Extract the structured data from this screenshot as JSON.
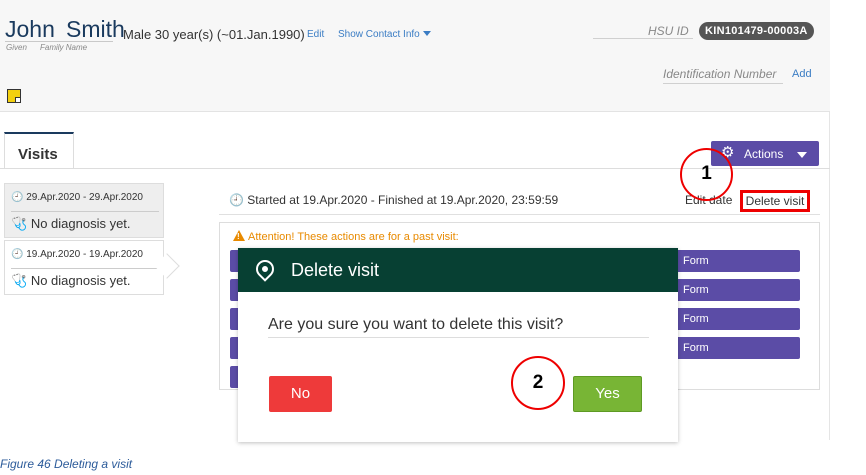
{
  "patient": {
    "given": "John",
    "family": "Smith",
    "given_hint": "Given",
    "family_hint": "Family Name",
    "demographics": "Male  30 year(s) (~01.Jan.1990)",
    "edit_link": "Edit",
    "contact_link": "Show Contact Info",
    "hsu_label": "HSU ID",
    "hsu_id": "KIN101479-00003A",
    "id_label": "Identification Number",
    "id_add": "Add"
  },
  "tabs": {
    "visits": "Visits"
  },
  "actions": {
    "label": "Actions"
  },
  "visits": [
    {
      "dates": "29.Apr.2020 - 29.Apr.2020",
      "diagnosis": "No diagnosis yet."
    },
    {
      "dates": "19.Apr.2020 - 19.Apr.2020",
      "diagnosis": "No diagnosis yet."
    }
  ],
  "visit_detail": {
    "started": "Started at 19.Apr.2020 - Finished at 19.Apr.2020, 23:59:59",
    "edit_date": "Edit date",
    "delete_visit": "Delete visit",
    "attention": "Attention! These actions are for a past visit:",
    "forms": [
      "Form",
      "Form",
      "Form",
      "Form"
    ]
  },
  "dialog": {
    "title": "Delete visit",
    "question": "Are you sure you want to delete this visit?",
    "no": "No",
    "yes": "Yes"
  },
  "annotations": {
    "callout_1": "1",
    "callout_2": "2"
  },
  "caption": "Figure 46 Deleting a visit",
  "colors": {
    "primary_purple": "#5b4ca6",
    "dialog_header": "#074033",
    "no_button": "#ee3a3a",
    "yes_button": "#78b535",
    "annotation_red": "#e00000",
    "warning_orange": "#e88a00"
  }
}
